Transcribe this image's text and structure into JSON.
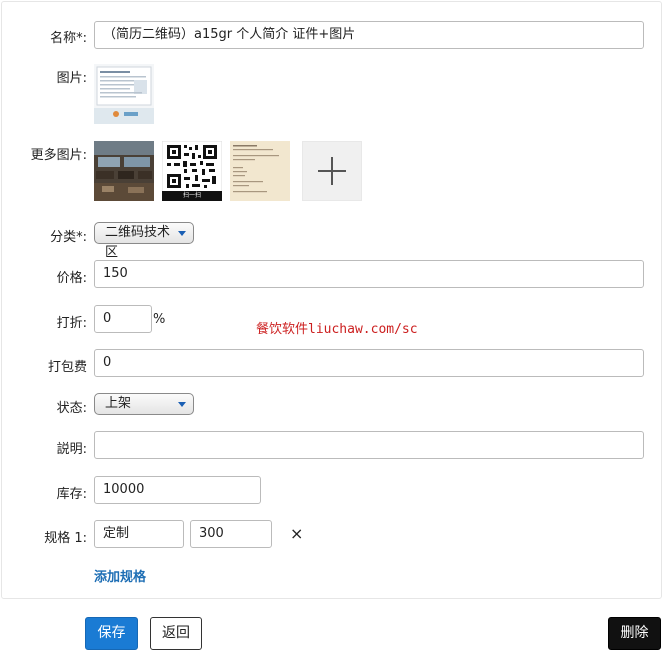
{
  "form": {
    "name_label": "名称*:",
    "name_value": "（简历二维码）a15gr 个人简介 证件+图片",
    "image_label": "图片:",
    "more_images_label": "更多图片:",
    "category_label": "分类*:",
    "category_value": "二维码技术区",
    "price_label": "价格:",
    "price_value": "150",
    "discount_label": "打折:",
    "discount_value": "0",
    "discount_unit": "%",
    "packing_fee_label": "打包费",
    "packing_fee_value": "0",
    "status_label": "状态:",
    "status_value": "上架",
    "desc_label": "説明:",
    "desc_value": "",
    "stock_label": "库存:",
    "stock_value": "10000",
    "spec_label": "规格 1:",
    "spec_name_value": "定制",
    "spec_price_value": "300",
    "spec_remove": "×",
    "add_spec_link": "添加规格",
    "qr_caption": "扫一扫"
  },
  "watermark": "餐饮软件liuchaw.com/sc",
  "actions": {
    "save_label": "保存",
    "back_label": "返回",
    "delete_label": "删除"
  },
  "colors": {
    "primary": "#1a7bd4",
    "link": "#1f6fb5",
    "danger_dark": "#111111",
    "watermark": "#cc1f1f"
  }
}
